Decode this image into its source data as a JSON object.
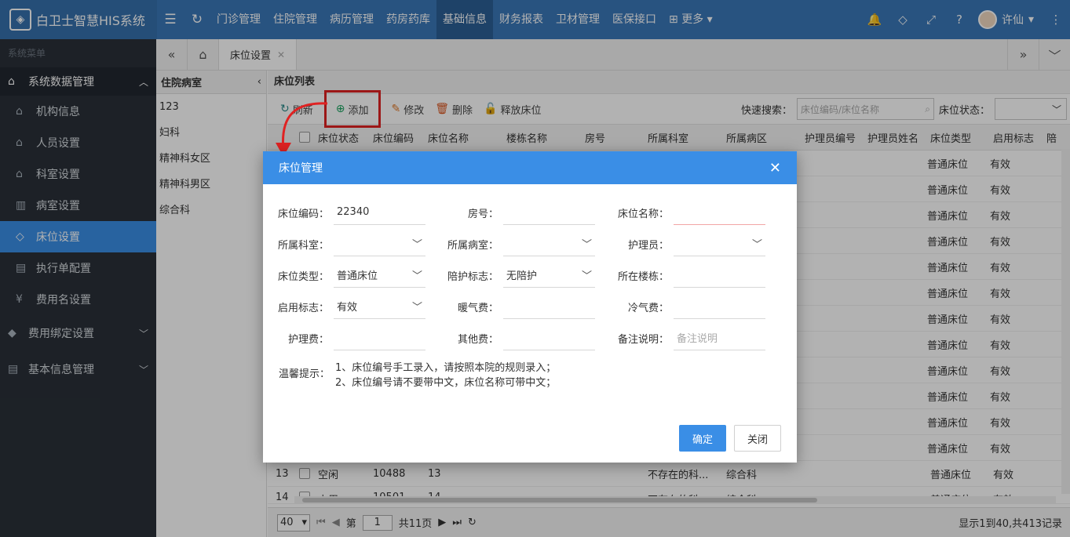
{
  "app": {
    "title": "白卫士智慧HIS系统"
  },
  "topnav": [
    "门诊管理",
    "住院管理",
    "病历管理",
    "药房药库",
    "基础信息",
    "财务报表",
    "卫材管理",
    "医保接口",
    "更多"
  ],
  "user": {
    "name": "许仙"
  },
  "sidebar": {
    "title": "系统菜单",
    "group": "系统数据管理",
    "items": [
      {
        "label": "机构信息",
        "icon": "home-icon"
      },
      {
        "label": "人员设置",
        "icon": "home-icon"
      },
      {
        "label": "科室设置",
        "icon": "home-icon"
      },
      {
        "label": "病室设置",
        "icon": "building-icon"
      },
      {
        "label": "床位设置",
        "icon": "tag-icon"
      },
      {
        "label": "执行单配置",
        "icon": "calendar-icon"
      },
      {
        "label": "费用名设置",
        "icon": "yen-icon"
      }
    ],
    "group2": "费用绑定设置",
    "group3": "基本信息管理"
  },
  "tabs": {
    "active": "床位设置"
  },
  "ward": {
    "title": "住院病室",
    "items": [
      "123",
      "妇科",
      "精神科女区",
      "精神科男区",
      "综合科"
    ]
  },
  "list": {
    "title": "床位列表",
    "toolbar": {
      "refresh": "刷新",
      "add": "添加",
      "edit": "修改",
      "delete": "删除",
      "release": "释放床位"
    },
    "search_label": "快速搜索：",
    "search_placeholder": "床位编码/床位名称",
    "status_label": "床位状态：",
    "columns": [
      "床位状态",
      "床位编码",
      "床位名称",
      "楼栋名称",
      "房号",
      "所属科室",
      "所属病区",
      "护理员编号",
      "护理员姓名",
      "床位类型",
      "启用标志",
      "陪"
    ],
    "bg_rows": [
      {
        "type": "普通床位",
        "flag": "有效"
      },
      {
        "type": "普通床位",
        "flag": "有效"
      },
      {
        "type": "普通床位",
        "flag": "有效"
      },
      {
        "type": "普通床位",
        "flag": "有效"
      },
      {
        "type": "普通床位",
        "flag": "有效"
      },
      {
        "type": "普通床位",
        "flag": "有效"
      },
      {
        "type": "普通床位",
        "flag": "有效"
      },
      {
        "type": "普通床位",
        "flag": "有效"
      },
      {
        "type": "普通床位",
        "flag": "有效"
      },
      {
        "type": "普通床位",
        "flag": "有效"
      },
      {
        "type": "普通床位",
        "flag": "有效"
      },
      {
        "type": "普通床位",
        "flag": "有效"
      }
    ],
    "row13": {
      "no": "13",
      "status": "空闲",
      "code": "10488",
      "name": "13",
      "dept": "不存在的科...",
      "area": "综合科",
      "type": "普通床位",
      "flag": "有效"
    },
    "row14": {
      "no": "14",
      "status": "占用",
      "code": "10501",
      "name": "14",
      "dept": "不存在的科...",
      "area": "综合科",
      "type": "普通床位",
      "flag": "有效"
    }
  },
  "pager": {
    "size": "40",
    "page_label": "第",
    "page": "1",
    "total_pages": "共11页",
    "info": "显示1到40,共413记录"
  },
  "dialog": {
    "title": "床位管理",
    "fields": {
      "bed_code": {
        "label": "床位编码：",
        "value": "22340"
      },
      "room_no": {
        "label": "房号：",
        "value": ""
      },
      "bed_name": {
        "label": "床位名称：",
        "value": ""
      },
      "dept": {
        "label": "所属科室：",
        "value": ""
      },
      "ward": {
        "label": "所属病室：",
        "value": ""
      },
      "nurse": {
        "label": "护理员：",
        "value": ""
      },
      "bed_type": {
        "label": "床位类型：",
        "value": "普通床位"
      },
      "escort": {
        "label": "陪护标志：",
        "value": "无陪护"
      },
      "building": {
        "label": "所在楼栋：",
        "value": ""
      },
      "enabled": {
        "label": "启用标志：",
        "value": "有效"
      },
      "heating": {
        "label": "暖气费：",
        "value": ""
      },
      "cooling": {
        "label": "冷气费：",
        "value": ""
      },
      "nursing_fee": {
        "label": "护理费：",
        "value": ""
      },
      "other_fee": {
        "label": "其他费：",
        "value": ""
      },
      "remark": {
        "label": "备注说明：",
        "placeholder": "备注说明"
      }
    },
    "tip_label": "温馨提示：",
    "tips": [
      "1、床位编号手工录入，请按照本院的规则录入；",
      "2、床位编号请不要带中文，床位名称可带中文；"
    ],
    "ok": "确定",
    "cancel": "关闭"
  }
}
